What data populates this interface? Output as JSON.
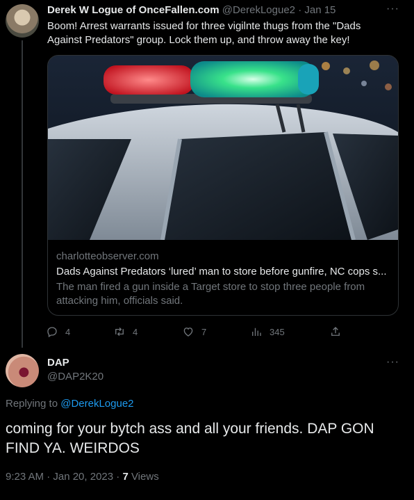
{
  "tweet1": {
    "author_name": "Derek W Logue of OnceFallen.com",
    "handle": "@DerekLogue2",
    "separator": "·",
    "date": "Jan 15",
    "text": "Boom! Arrest warrants issued for three vigilnte thugs from the \"Dads Against Predators\" group. Lock them up, and throw away the key!",
    "card": {
      "domain": "charlotteobserver.com",
      "title": "Dads Against Predators ‘lured’ man to store before gunfire, NC cops s...",
      "description": "The man fired a gun inside a Target store to stop three people from attacking him, officials said."
    },
    "stats": {
      "replies": "4",
      "retweets": "4",
      "likes": "7",
      "views": "345"
    },
    "icons": [
      "reply-icon",
      "retweet-icon",
      "like-icon",
      "views-icon",
      "share-icon",
      "more-icon"
    ]
  },
  "tweet2": {
    "author_name": "DAP",
    "handle": "@DAP2K20",
    "replying_prefix": "Replying to",
    "replying_handle": "@DerekLogue2",
    "text": "coming for your bytch ass and all your friends. DAP GON FIND YA. WEIRDOS",
    "timestamp": "9:23 AM · Jan 20, 2023 · ",
    "views_count": "7",
    "views_label": " Views"
  },
  "colors": {
    "background": "#000000",
    "primary_text": "#e7e9ea",
    "secondary_text": "#71767b",
    "link": "#1d9bf0",
    "border": "#2f3336"
  }
}
